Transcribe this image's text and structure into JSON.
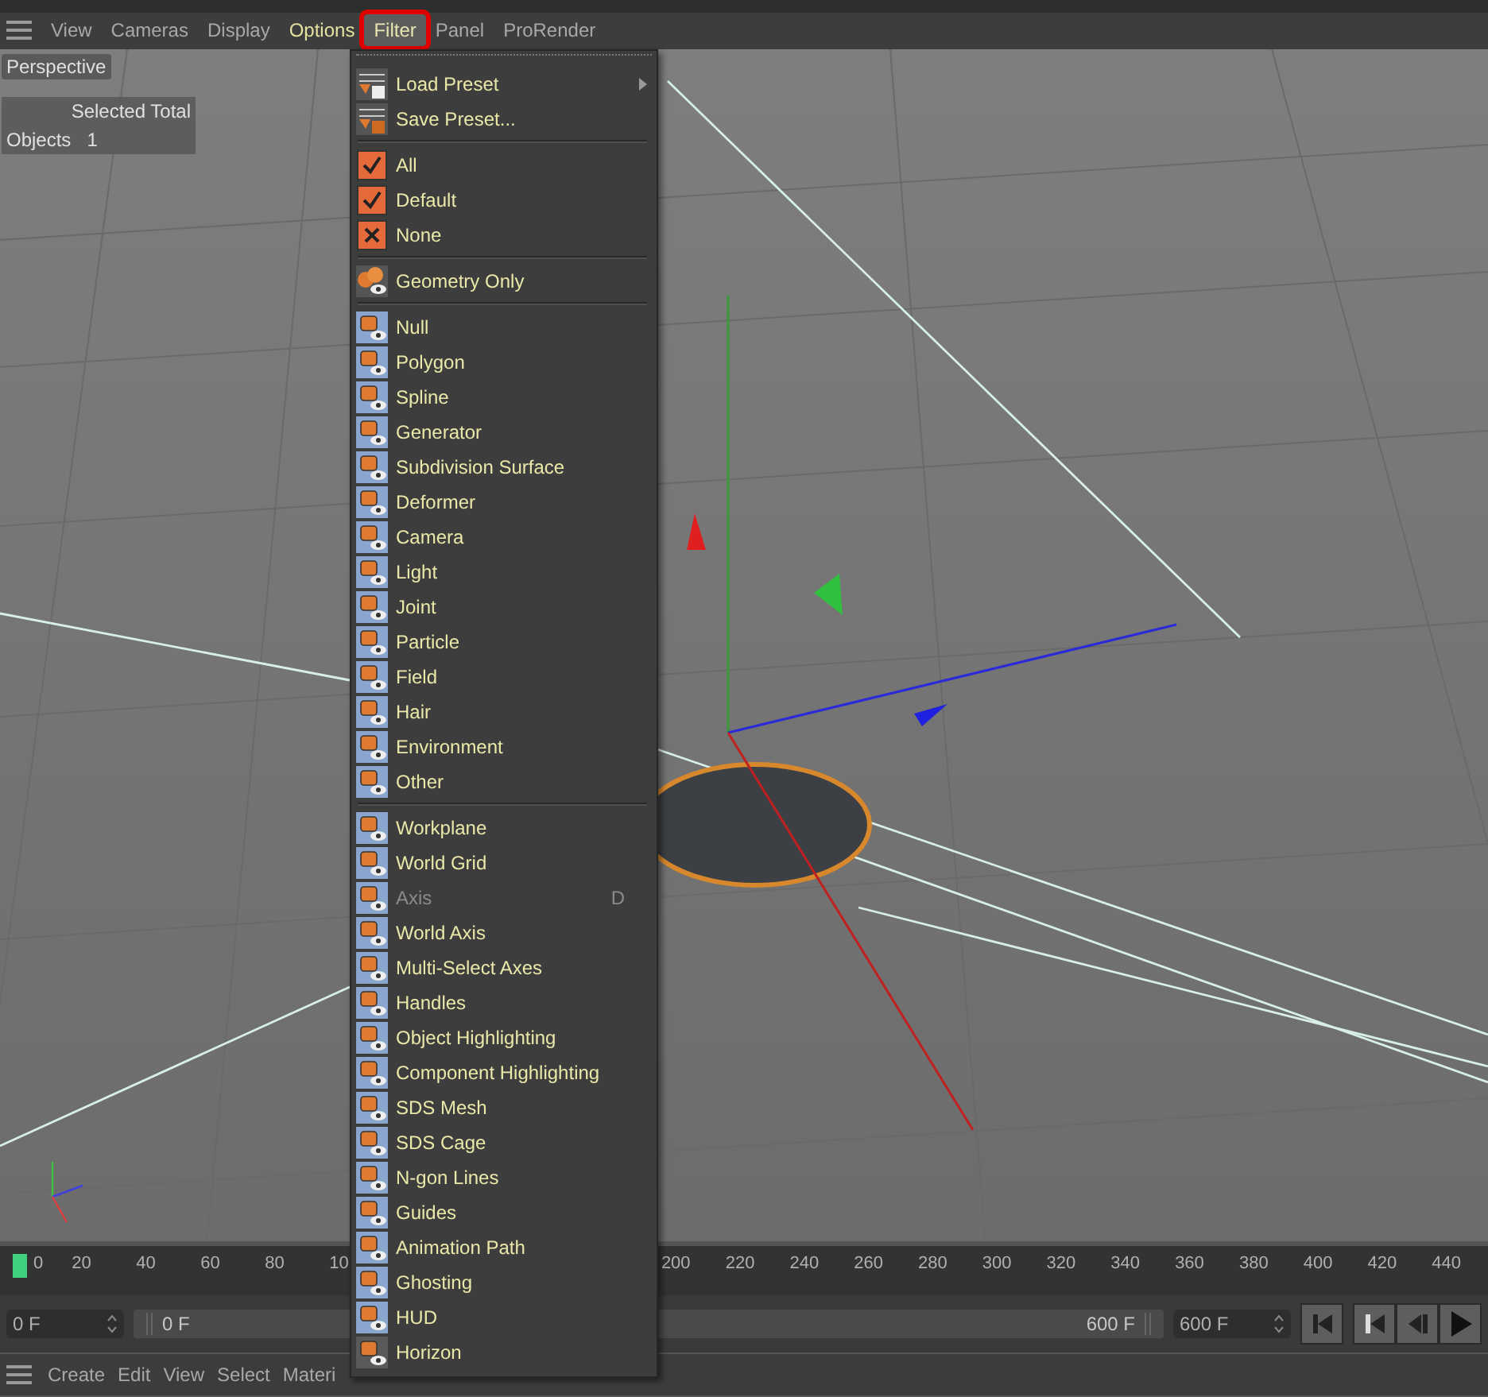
{
  "view_menu": [
    {
      "label": "View",
      "selected": false,
      "highlighted": false
    },
    {
      "label": "Cameras",
      "selected": false,
      "highlighted": false
    },
    {
      "label": "Display",
      "selected": false,
      "highlighted": false
    },
    {
      "label": "Options",
      "selected": false,
      "highlighted": true
    },
    {
      "label": "Filter",
      "selected": true,
      "highlighted": false
    },
    {
      "label": "Panel",
      "selected": false,
      "highlighted": false
    },
    {
      "label": "ProRender",
      "selected": false,
      "highlighted": false
    }
  ],
  "viewport": {
    "camera_label": "Perspective",
    "hud": {
      "header": "Selected Total",
      "row_label": "Objects",
      "row_value": "1"
    }
  },
  "filter_menu": {
    "groups": [
      [
        {
          "label": "Load Preset",
          "kind": "preset",
          "submenu": true
        },
        {
          "label": "Save Preset...",
          "kind": "preset",
          "submenu": false
        }
      ],
      [
        {
          "label": "All",
          "kind": "check"
        },
        {
          "label": "Default",
          "kind": "check"
        },
        {
          "label": "None",
          "kind": "cross"
        }
      ],
      [
        {
          "label": "Geometry Only",
          "kind": "command"
        }
      ],
      [
        {
          "label": "Null",
          "kind": "filter",
          "on": true,
          "disabled": false
        },
        {
          "label": "Polygon",
          "kind": "filter",
          "on": true,
          "disabled": false
        },
        {
          "label": "Spline",
          "kind": "filter",
          "on": true,
          "disabled": false
        },
        {
          "label": "Generator",
          "kind": "filter",
          "on": true,
          "disabled": false
        },
        {
          "label": "Subdivision Surface",
          "kind": "filter",
          "on": true,
          "disabled": false
        },
        {
          "label": "Deformer",
          "kind": "filter",
          "on": true,
          "disabled": false
        },
        {
          "label": "Camera",
          "kind": "filter",
          "on": true,
          "disabled": false
        },
        {
          "label": "Light",
          "kind": "filter",
          "on": true,
          "disabled": false
        },
        {
          "label": "Joint",
          "kind": "filter",
          "on": true,
          "disabled": false
        },
        {
          "label": "Particle",
          "kind": "filter",
          "on": true,
          "disabled": false
        },
        {
          "label": "Field",
          "kind": "filter",
          "on": true,
          "disabled": false
        },
        {
          "label": "Hair",
          "kind": "filter",
          "on": true,
          "disabled": false
        },
        {
          "label": "Environment",
          "kind": "filter",
          "on": true,
          "disabled": false
        },
        {
          "label": "Other",
          "kind": "filter",
          "on": true,
          "disabled": false
        }
      ],
      [
        {
          "label": "Workplane",
          "kind": "filter",
          "on": true,
          "disabled": false
        },
        {
          "label": "World Grid",
          "kind": "filter",
          "on": true,
          "disabled": false
        },
        {
          "label": "Axis",
          "kind": "filter",
          "on": true,
          "disabled": true,
          "shortcut": "D"
        },
        {
          "label": "World Axis",
          "kind": "filter",
          "on": true,
          "disabled": false
        },
        {
          "label": "Multi-Select Axes",
          "kind": "filter",
          "on": true,
          "disabled": false
        },
        {
          "label": "Handles",
          "kind": "filter",
          "on": true,
          "disabled": false
        },
        {
          "label": "Object Highlighting",
          "kind": "filter",
          "on": true,
          "disabled": false
        },
        {
          "label": "Component Highlighting",
          "kind": "filter",
          "on": true,
          "disabled": false
        },
        {
          "label": "SDS Mesh",
          "kind": "filter",
          "on": true,
          "disabled": false
        },
        {
          "label": "SDS Cage",
          "kind": "filter",
          "on": true,
          "disabled": false
        },
        {
          "label": "N-gon Lines",
          "kind": "filter",
          "on": true,
          "disabled": false
        },
        {
          "label": "Guides",
          "kind": "filter",
          "on": true,
          "disabled": false
        },
        {
          "label": "Animation Path",
          "kind": "filter",
          "on": true,
          "disabled": false
        },
        {
          "label": "Ghosting",
          "kind": "filter",
          "on": true,
          "disabled": false
        },
        {
          "label": "HUD",
          "kind": "filter",
          "on": true,
          "disabled": false
        },
        {
          "label": "Horizon",
          "kind": "filter",
          "on": false,
          "disabled": false
        }
      ]
    ]
  },
  "timeline": {
    "left_labels": [
      "0",
      "20",
      "40",
      "60",
      "80",
      "10"
    ],
    "right_labels": [
      "200",
      "220",
      "240",
      "260",
      "280",
      "300",
      "320",
      "340",
      "360",
      "380",
      "400",
      "420",
      "440"
    ]
  },
  "frame_controls": {
    "start_field": "0 F",
    "range_start": "0 F",
    "range_end": "600 F",
    "end_field": "600 F"
  },
  "bottom_menu": [
    "Create",
    "Edit",
    "View",
    "Select",
    "Materi"
  ]
}
